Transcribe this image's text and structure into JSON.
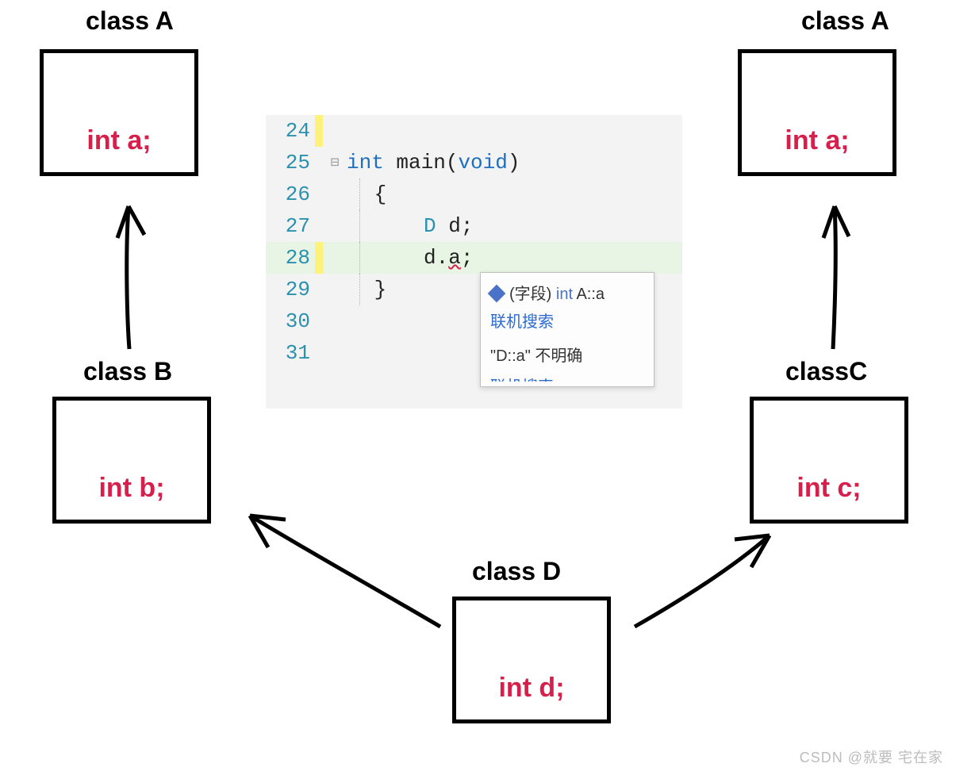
{
  "classes": {
    "a_left": {
      "label": "class A",
      "member": "int a;"
    },
    "a_right": {
      "label": "class A",
      "member": "int a;"
    },
    "b": {
      "label": "class B",
      "member": "int b;"
    },
    "c": {
      "label": "classC",
      "member": "int c;"
    },
    "d": {
      "label": "class D",
      "member": "int d;"
    }
  },
  "code": {
    "lines": [
      "24",
      "25",
      "26",
      "27",
      "28",
      "29",
      "30",
      "31"
    ],
    "l25_kw_int": "int",
    "l25_main": " main(",
    "l25_void": "void",
    "l25_close": ")",
    "l26": "{",
    "l27_type": "D",
    "l27_rest": " d;",
    "l28_pre": "d.",
    "l28_a": "a",
    "l28_post": ";",
    "l29": "}"
  },
  "tooltip": {
    "field_prefix": "(字段) ",
    "field_type": "int ",
    "field_name": "A::a",
    "link": "联机搜索",
    "error": "\"D::a\" 不明确",
    "cut": "联机搜索"
  },
  "watermark": "CSDN @就要 宅在家"
}
